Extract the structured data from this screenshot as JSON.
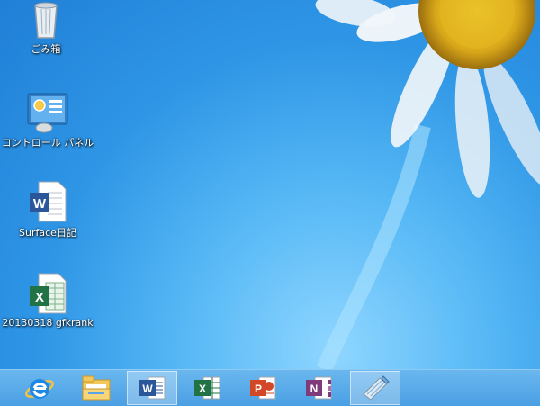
{
  "desktop": {
    "icons": [
      {
        "label": "ごみ箱",
        "icon": "recycle-bin-icon"
      },
      {
        "label": "コントロール パネル",
        "icon": "control-panel-icon"
      },
      {
        "label": "Surface日記",
        "icon": "word-document-icon"
      },
      {
        "label": "20130318 gfkrank",
        "icon": "excel-document-icon"
      }
    ]
  },
  "taskbar": {
    "buttons": [
      {
        "icon": "internet-explorer-icon",
        "active": false
      },
      {
        "icon": "file-explorer-icon",
        "active": false
      },
      {
        "icon": "word-icon",
        "active": true,
        "letter": "W"
      },
      {
        "icon": "excel-icon",
        "active": false,
        "letter": "X"
      },
      {
        "icon": "powerpoint-icon",
        "active": false,
        "letter": "P"
      },
      {
        "icon": "onenote-icon",
        "active": false,
        "letter": "N"
      },
      {
        "icon": "journal-icon",
        "active": true
      }
    ]
  },
  "colors": {
    "word": "#2b579a",
    "excel": "#217346",
    "powerpoint": "#d24726",
    "onenote": "#80397b"
  }
}
